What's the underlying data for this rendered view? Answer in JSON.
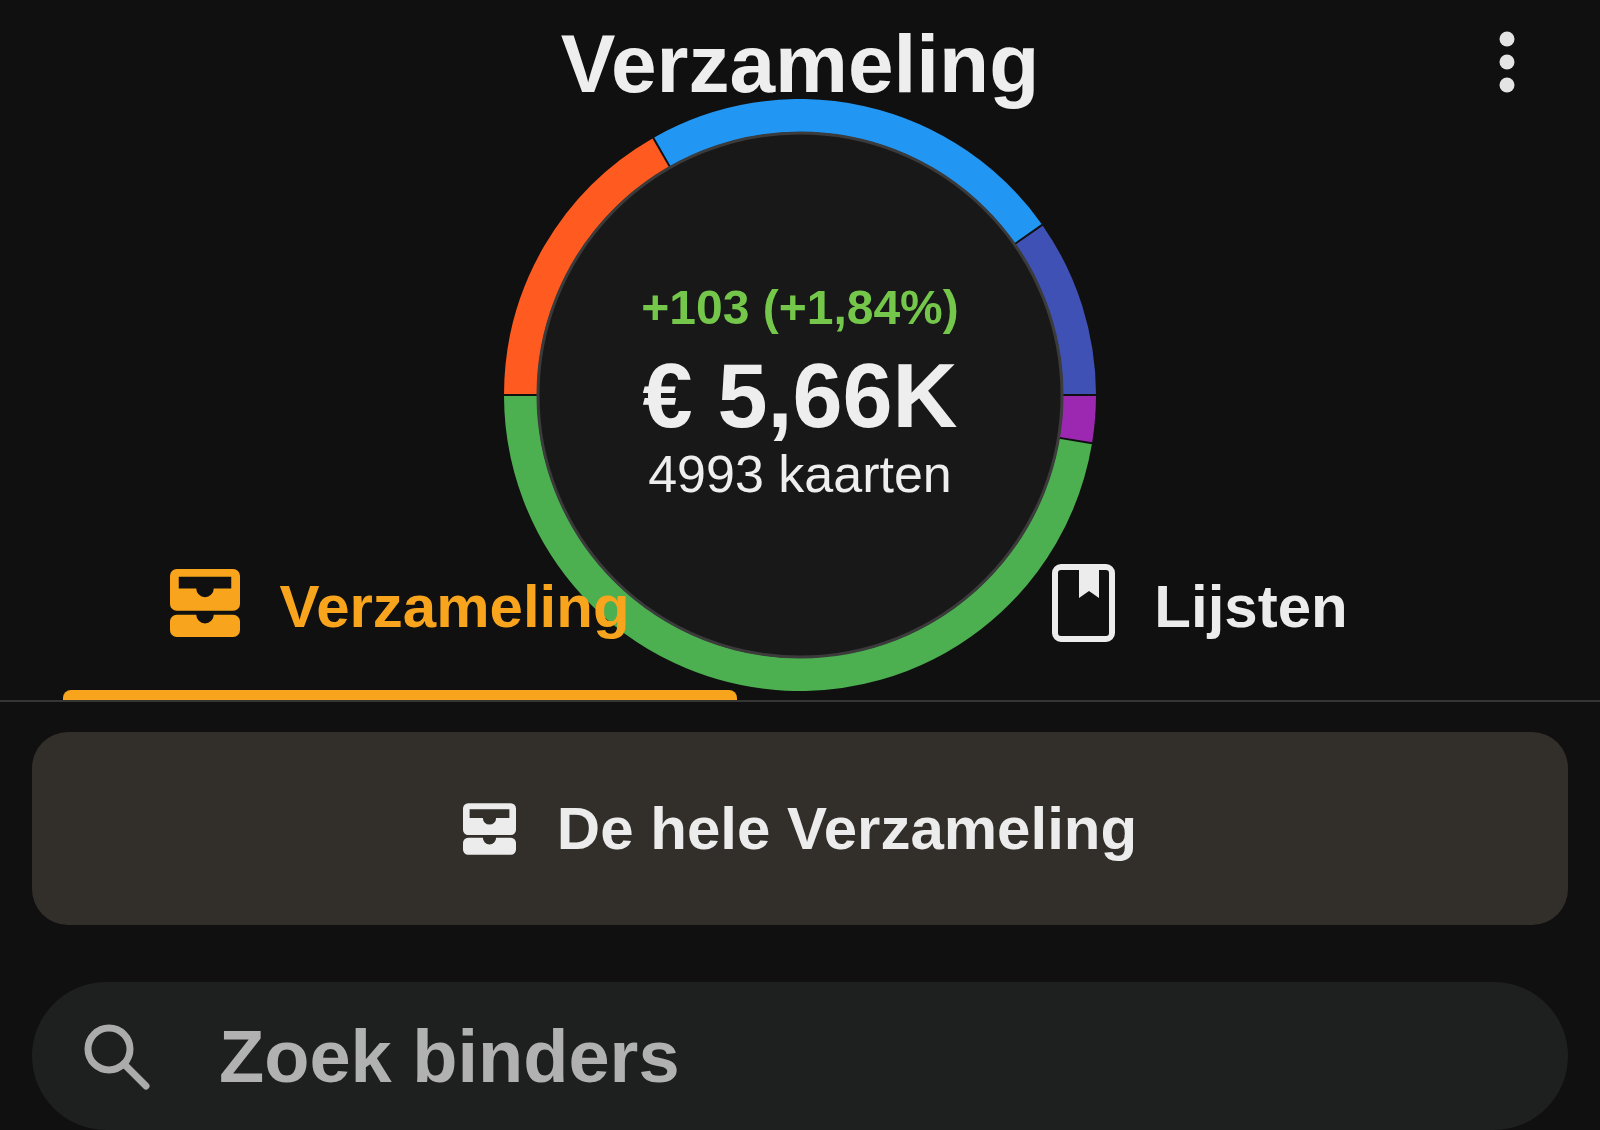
{
  "header": {
    "title": "Verzameling"
  },
  "summary": {
    "change": "+103 (+1,84%)",
    "value": "€ 5,66K",
    "count": "4993 kaarten"
  },
  "tabs": [
    {
      "label": "Verzameling",
      "selected": true
    },
    {
      "label": "Lijsten",
      "selected": false
    }
  ],
  "collection_button": {
    "label": "De hele Verzameling"
  },
  "search": {
    "placeholder": "Zoek binders"
  }
}
